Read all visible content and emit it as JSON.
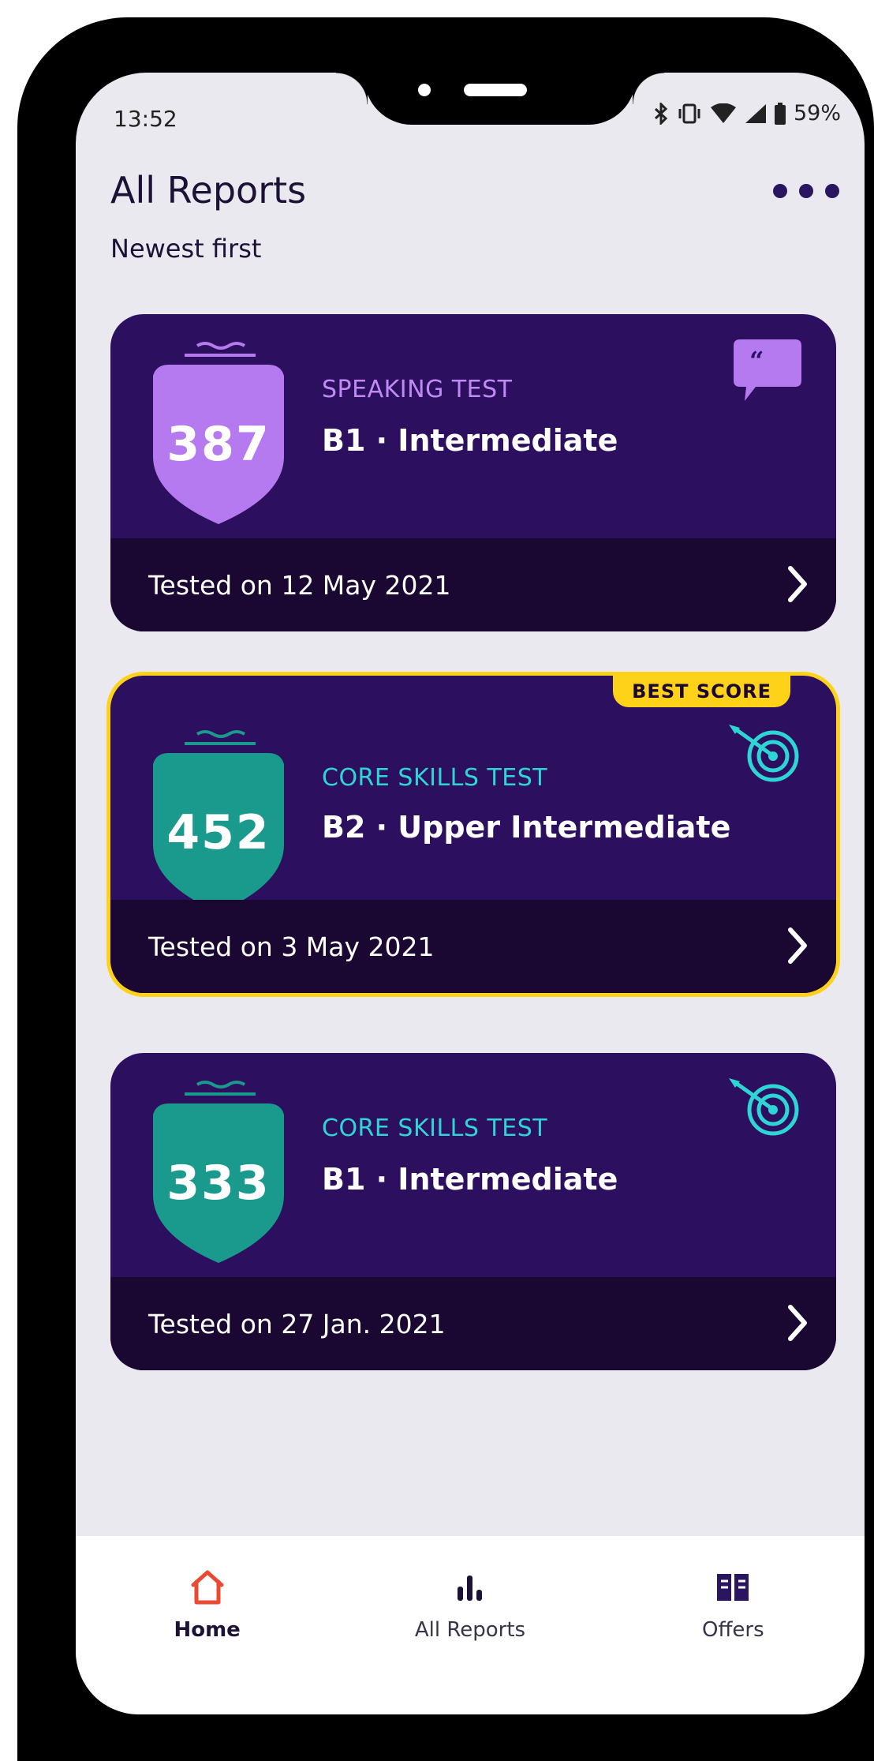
{
  "status_bar": {
    "time": "13:52",
    "battery": "59%",
    "icons": [
      "bluetooth-icon",
      "vibrate-icon",
      "wifi-icon",
      "signal-icon",
      "battery-icon"
    ]
  },
  "header": {
    "title": "All Reports",
    "subtitle": "Newest first",
    "more_icon": "more-dots-icon"
  },
  "reports": [
    {
      "score": "387",
      "test_type": "SPEAKING TEST",
      "level": "B1 · Intermediate",
      "date": "Tested on 12 May 2021",
      "icon": "speech-bubble-icon",
      "best": false
    },
    {
      "score": "452",
      "test_type": "CORE SKILLS TEST",
      "level": "B2 · Upper Intermediate",
      "date": "Tested on 3 May 2021",
      "icon": "target-icon",
      "best": true,
      "badge": "BEST SCORE"
    },
    {
      "score": "333",
      "test_type": "CORE SKILLS TEST",
      "level": "B1 · Intermediate",
      "date": "Tested on 27 Jan. 2021",
      "icon": "target-icon",
      "best": false
    }
  ],
  "nav": {
    "home": "Home",
    "reports": "All Reports",
    "offers": "Offers"
  },
  "colors": {
    "card_bg": "#2d0f5f",
    "card_footer": "#1a0833",
    "speaking_shield": "#b57af0",
    "core_shield": "#199a8c",
    "speaking_label": "#c08af5",
    "core_label": "#2ed5d5",
    "best_badge": "#ffd21a",
    "home_icon": "#e94a34"
  }
}
